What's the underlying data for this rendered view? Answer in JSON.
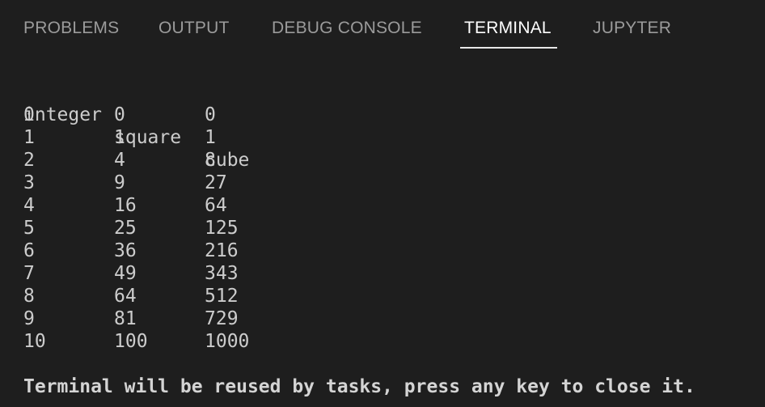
{
  "tabs": [
    {
      "label": "PROBLEMS",
      "active": false
    },
    {
      "label": "OUTPUT",
      "active": false
    },
    {
      "label": "DEBUG CONSOLE",
      "active": false
    },
    {
      "label": "TERMINAL",
      "active": true
    },
    {
      "label": "JUPYTER",
      "active": false
    }
  ],
  "terminal": {
    "header": [
      "integer",
      "square",
      "cube"
    ],
    "rows": [
      [
        "0",
        "0",
        "0"
      ],
      [
        "1",
        "1",
        "1"
      ],
      [
        "2",
        "4",
        "8"
      ],
      [
        "3",
        "9",
        "27"
      ],
      [
        "4",
        "16",
        "64"
      ],
      [
        "5",
        "25",
        "125"
      ],
      [
        "6",
        "36",
        "216"
      ],
      [
        "7",
        "49",
        "343"
      ],
      [
        "8",
        "64",
        "512"
      ],
      [
        "9",
        "81",
        "729"
      ],
      [
        "10",
        "100",
        "1000"
      ]
    ],
    "status": "Terminal will be reused by tasks, press any key to close it."
  },
  "colors": {
    "background": "#1e1e1e",
    "tab_inactive": "#9b9b9b",
    "tab_active": "#ffffff",
    "text": "#cccccc"
  }
}
